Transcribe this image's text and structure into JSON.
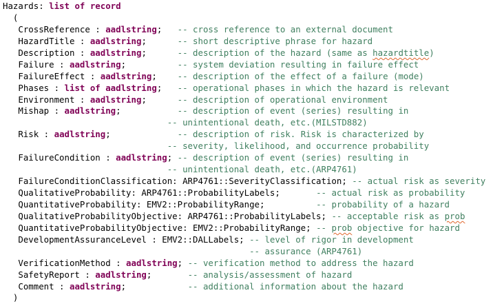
{
  "code_lines": [
    {
      "id": "hazards-header",
      "parts": [
        {
          "t": "Hazards: ",
          "c": "txt"
        },
        {
          "t": "list of record",
          "c": "kw"
        }
      ]
    },
    {
      "id": "open-paren",
      "parts": [
        {
          "t": "  (",
          "c": "txt"
        }
      ]
    },
    {
      "id": "crossreference",
      "parts": [
        {
          "t": "   CrossReference : ",
          "c": "txt"
        },
        {
          "t": "aadlstring",
          "c": "kw"
        },
        {
          "t": ";   ",
          "c": "txt"
        },
        {
          "t": "-- cross reference to an external document",
          "c": "cm"
        }
      ]
    },
    {
      "id": "hazardtitle",
      "parts": [
        {
          "t": "   HazardTitle : ",
          "c": "txt"
        },
        {
          "t": "aadlstring",
          "c": "kw"
        },
        {
          "t": ";      ",
          "c": "txt"
        },
        {
          "t": "-- short descriptive phrase for hazard",
          "c": "cm"
        }
      ]
    },
    {
      "id": "description",
      "parts": [
        {
          "t": "   Description : ",
          "c": "txt"
        },
        {
          "t": "aadlstring",
          "c": "kw"
        },
        {
          "t": ";      ",
          "c": "txt"
        },
        {
          "t": "-- description of the hazard (same as ",
          "c": "cm"
        },
        {
          "t": "hazardtitle",
          "c": "cm squig"
        },
        {
          "t": ")",
          "c": "cm"
        }
      ]
    },
    {
      "id": "failure",
      "parts": [
        {
          "t": "   Failure : ",
          "c": "txt"
        },
        {
          "t": "aadlstring",
          "c": "kw"
        },
        {
          "t": ";          ",
          "c": "txt"
        },
        {
          "t": "-- system deviation resulting in failure effect",
          "c": "cm"
        }
      ]
    },
    {
      "id": "failureeffect",
      "parts": [
        {
          "t": "   FailureEffect : ",
          "c": "txt"
        },
        {
          "t": "aadlstring",
          "c": "kw"
        },
        {
          "t": ";    ",
          "c": "txt"
        },
        {
          "t": "-- description of the effect of a failure (mode)",
          "c": "cm"
        }
      ]
    },
    {
      "id": "phases",
      "parts": [
        {
          "t": "   Phases : ",
          "c": "txt"
        },
        {
          "t": "list of aadlstring",
          "c": "kw"
        },
        {
          "t": ";   ",
          "c": "txt"
        },
        {
          "t": "-- operational phases in which the hazard is relevant",
          "c": "cm"
        }
      ]
    },
    {
      "id": "environment",
      "parts": [
        {
          "t": "   Environment : ",
          "c": "txt"
        },
        {
          "t": "aadlstring",
          "c": "kw"
        },
        {
          "t": ";      ",
          "c": "txt"
        },
        {
          "t": "-- description of operational environment",
          "c": "cm"
        }
      ]
    },
    {
      "id": "mishap",
      "parts": [
        {
          "t": "   Mishap : ",
          "c": "txt"
        },
        {
          "t": "aadlstring",
          "c": "kw"
        },
        {
          "t": ";           ",
          "c": "txt"
        },
        {
          "t": "-- description of event (series) resulting in",
          "c": "cm"
        }
      ]
    },
    {
      "id": "mishap-cont",
      "parts": [
        {
          "t": "                                ",
          "c": "txt"
        },
        {
          "t": "-- unintentional death, etc.(MILSTD882)",
          "c": "cm"
        }
      ]
    },
    {
      "id": "risk",
      "parts": [
        {
          "t": "   Risk : ",
          "c": "txt"
        },
        {
          "t": "aadlstring",
          "c": "kw"
        },
        {
          "t": ";             ",
          "c": "txt"
        },
        {
          "t": "-- description of risk. Risk is characterized by",
          "c": "cm"
        }
      ]
    },
    {
      "id": "risk-cont",
      "parts": [
        {
          "t": "                                ",
          "c": "txt"
        },
        {
          "t": "-- severity, likelihood, and occurrence probability",
          "c": "cm"
        }
      ]
    },
    {
      "id": "failurecondition",
      "parts": [
        {
          "t": "   FailureCondition : ",
          "c": "txt"
        },
        {
          "t": "aadlstring",
          "c": "kw"
        },
        {
          "t": "; ",
          "c": "txt"
        },
        {
          "t": "-- description of event (series) resulting in",
          "c": "cm"
        }
      ]
    },
    {
      "id": "failurecondition-cont",
      "parts": [
        {
          "t": "                                ",
          "c": "txt"
        },
        {
          "t": "-- unintentional death, etc.(ARP4761)",
          "c": "cm"
        }
      ]
    },
    {
      "id": "failureconditionclassification",
      "parts": [
        {
          "t": "   FailureConditionClassification: ARP4761::SeverityClassification; ",
          "c": "txt"
        },
        {
          "t": "-- actual risk as severity",
          "c": "cm"
        }
      ]
    },
    {
      "id": "qualitativeprobability",
      "parts": [
        {
          "t": "   QualitativeProbability: ARP4761::ProbabilityLabels;       ",
          "c": "txt"
        },
        {
          "t": "-- actual risk as probability",
          "c": "cm"
        }
      ]
    },
    {
      "id": "quantitativeprobability",
      "parts": [
        {
          "t": "   QuantitativeProbability: EMV2::ProbabilityRange;          ",
          "c": "txt"
        },
        {
          "t": "-- probability of a hazard",
          "c": "cm"
        }
      ]
    },
    {
      "id": "qualitativeprobabilityobjective",
      "parts": [
        {
          "t": "   QualitativeProbabilityObjective: ARP4761::ProbabilityLabels; ",
          "c": "txt"
        },
        {
          "t": "-- acceptable risk as ",
          "c": "cm"
        },
        {
          "t": "prob",
          "c": "cm squig"
        }
      ]
    },
    {
      "id": "quantitativeprobabilityobjective",
      "parts": [
        {
          "t": "   QuantitativeProbabilityObjective: EMV2::ProbabilityRange; ",
          "c": "txt"
        },
        {
          "t": "-- ",
          "c": "cm"
        },
        {
          "t": "prob",
          "c": "cm squig"
        },
        {
          "t": " objective for hazard",
          "c": "cm"
        }
      ]
    },
    {
      "id": "developmentassurancelevel",
      "parts": [
        {
          "t": "   DevelopmentAssuranceLevel : EMV2::DALLabels; ",
          "c": "txt"
        },
        {
          "t": "-- level of rigor in development",
          "c": "cm"
        }
      ]
    },
    {
      "id": "developmentassurancelevel-cont",
      "parts": [
        {
          "t": "                                                ",
          "c": "txt"
        },
        {
          "t": "-- assurance (ARP4761)",
          "c": "cm"
        }
      ]
    },
    {
      "id": "verificationmethod",
      "parts": [
        {
          "t": "   VerificationMethod : ",
          "c": "txt"
        },
        {
          "t": "aadlstring",
          "c": "kw"
        },
        {
          "t": "; ",
          "c": "txt"
        },
        {
          "t": "-- verification method to address the hazard",
          "c": "cm"
        }
      ]
    },
    {
      "id": "safetyreport",
      "parts": [
        {
          "t": "   SafetyReport : ",
          "c": "txt"
        },
        {
          "t": "aadlstring",
          "c": "kw"
        },
        {
          "t": ";       ",
          "c": "txt"
        },
        {
          "t": "-- analysis/assessment of hazard",
          "c": "cm"
        }
      ]
    },
    {
      "id": "comment",
      "parts": [
        {
          "t": "   Comment : ",
          "c": "txt"
        },
        {
          "t": "aadlstring",
          "c": "kw"
        },
        {
          "t": ";            ",
          "c": "txt"
        },
        {
          "t": "-- additional information about the hazard",
          "c": "cm"
        }
      ]
    },
    {
      "id": "close-paren",
      "parts": [
        {
          "t": "  )",
          "c": "txt"
        }
      ]
    }
  ],
  "colors": {
    "keyword": "#7f0055",
    "comment": "#3f7f5f",
    "text": "#000000",
    "spell_underline": "#e0652a",
    "background": "#ffffff"
  }
}
